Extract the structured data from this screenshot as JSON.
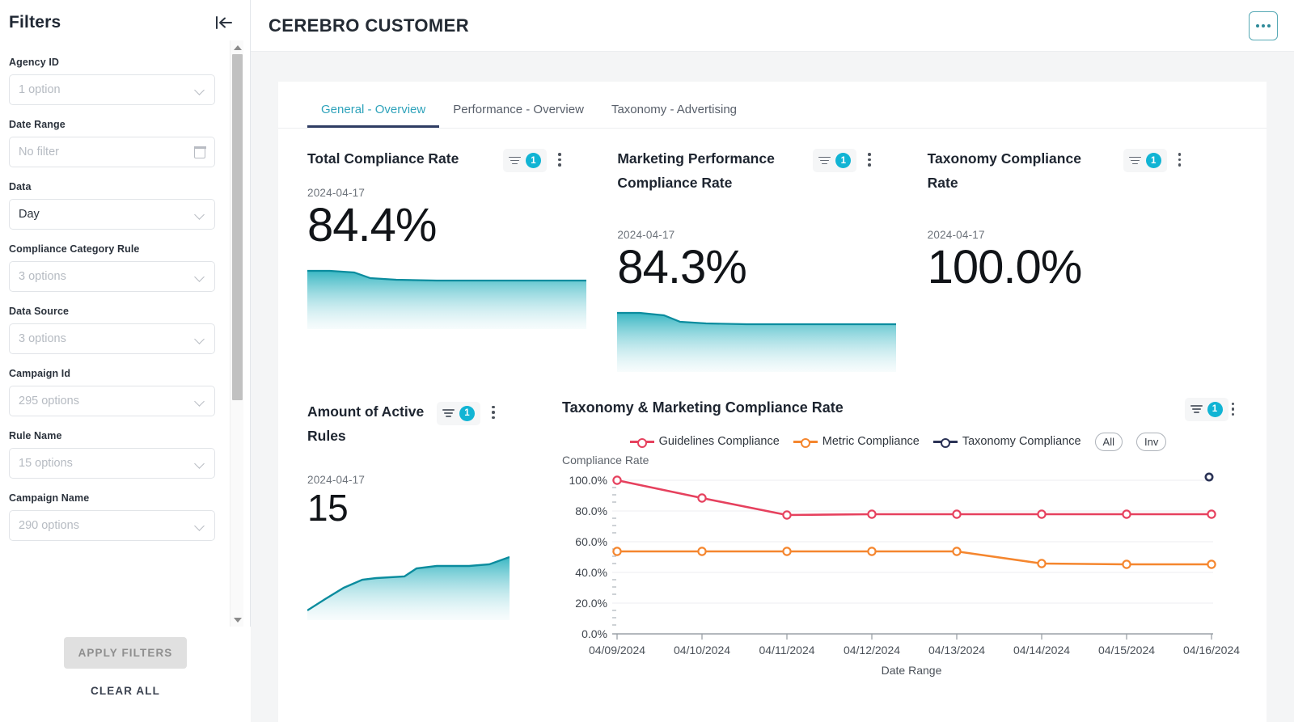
{
  "sidebar": {
    "title": "Filters",
    "collapse_icon": "collapse-left-icon",
    "filters": [
      {
        "label": "Agency ID",
        "value": "1 option",
        "icon": "chevron-down-icon"
      },
      {
        "label": "Date Range",
        "value": "No filter",
        "icon": "calendar-icon"
      },
      {
        "label": "Data",
        "value": "Day",
        "icon": "chevron-down-icon",
        "filled": true
      },
      {
        "label": "Compliance Category Rule",
        "value": "3 options",
        "icon": "chevron-down-icon"
      },
      {
        "label": "Data Source",
        "value": "3 options",
        "icon": "chevron-down-icon"
      },
      {
        "label": "Campaign Id",
        "value": "295 options",
        "icon": "chevron-down-icon"
      },
      {
        "label": "Rule Name",
        "value": "15 options",
        "icon": "chevron-down-icon"
      },
      {
        "label": "Campaign Name",
        "value": "290 options",
        "icon": "chevron-down-icon"
      }
    ],
    "apply_label": "APPLY FILTERS",
    "clear_label": "CLEAR ALL"
  },
  "header": {
    "title": "CEREBRO CUSTOMER",
    "menu_icon": "kebab-horizontal-icon"
  },
  "tabs": [
    {
      "label": "General - Overview",
      "active": true
    },
    {
      "label": "Performance - Overview",
      "active": false
    },
    {
      "label": "Taxonomy - Advertising",
      "active": false
    }
  ],
  "kpis": [
    {
      "title": "Total Compliance Rate",
      "date": "2024-04-17",
      "value": "84.4%",
      "filter_count": "1"
    },
    {
      "title": "Marketing Performance Compliance Rate",
      "date": "2024-04-17",
      "value": "84.3%",
      "filter_count": "1"
    },
    {
      "title": "Taxonomy Compliance Rate",
      "date": "2024-04-17",
      "value": "100.0%",
      "filter_count": "1"
    }
  ],
  "rules_card": {
    "title": "Amount of Active Rules",
    "date": "2024-04-17",
    "value": "15",
    "filter_count": "1"
  },
  "chart_card": {
    "title": "Taxonomy & Marketing Compliance Rate",
    "filter_count": "1",
    "pill_all": "All",
    "pill_inv": "Inv"
  },
  "colors": {
    "accent_teal": "#2fa3bb",
    "badge_cyan": "#11b4d4",
    "series_guidelines": "#e6415e",
    "series_metric": "#f5862e",
    "series_taxonomy": "#2b3356",
    "spark_line": "#0b8c9e",
    "tab_underline": "#2f3d63"
  },
  "chart_data": {
    "type": "line",
    "title": "Taxonomy & Marketing Compliance Rate",
    "xlabel": "Date Range",
    "ylabel": "Compliance Rate",
    "ylim": [
      0,
      100
    ],
    "yticks": [
      "0.0%",
      "20.0%",
      "40.0%",
      "60.0%",
      "80.0%",
      "100.0%"
    ],
    "grid": true,
    "legend_position": "top-center",
    "categories": [
      "04/09/2024",
      "04/10/2024",
      "04/11/2024",
      "04/12/2024",
      "04/13/2024",
      "04/14/2024",
      "04/15/2024",
      "04/16/2024"
    ],
    "series": [
      {
        "name": "Guidelines Compliance",
        "color": "#e6415e",
        "values": [
          100.0,
          94.0,
          85.0,
          85.2,
          85.2,
          85.2,
          85.2,
          85.2
        ]
      },
      {
        "name": "Metric Compliance",
        "color": "#f5862e",
        "values": [
          54.0,
          54.0,
          54.0,
          54.0,
          54.0,
          46.5,
          46.0,
          46.0
        ]
      },
      {
        "name": "Taxonomy Compliance",
        "color": "#2b3356",
        "values": [
          null,
          null,
          null,
          null,
          null,
          null,
          null,
          100.0
        ]
      }
    ]
  },
  "sparklines": {
    "total_compliance": [
      92,
      92,
      91,
      88,
      86,
      85.5,
      85.4,
      85.3,
      85.3,
      85.2,
      85.2,
      85.2,
      85.2,
      85.2
    ],
    "marketing_compliance": [
      92,
      92,
      91,
      88,
      86,
      85.5,
      85.4,
      85.3,
      85.3,
      85.2,
      85.2,
      85.2,
      85.2,
      85.2
    ],
    "active_rules": [
      2,
      4,
      6,
      8,
      9,
      9.2,
      9.3,
      9.4,
      11.5,
      11.8,
      11.9,
      12,
      12.1,
      14.5
    ]
  }
}
